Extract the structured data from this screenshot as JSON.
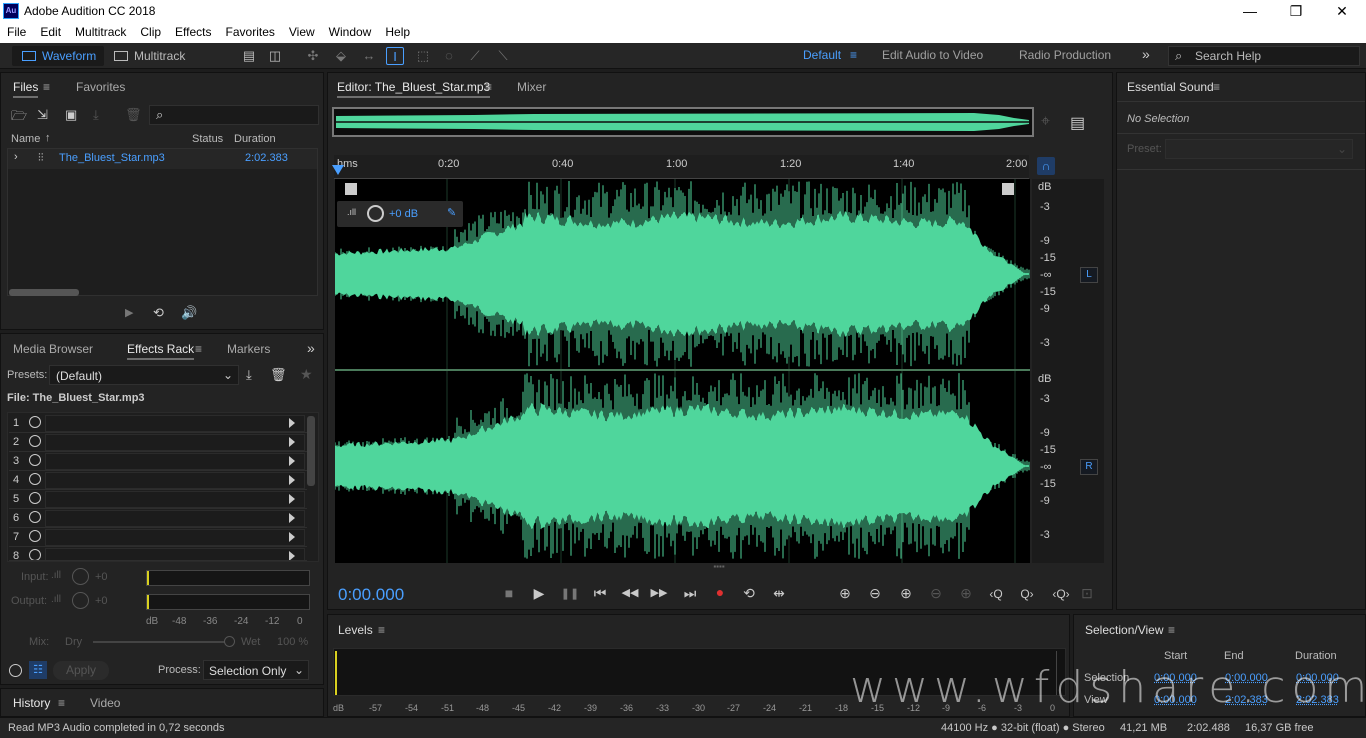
{
  "app": {
    "title": "Adobe Audition CC 2018",
    "icon_label": "Au"
  },
  "window_controls": {
    "minimize": "—",
    "maximize": "❐",
    "close": "✕"
  },
  "menu": [
    "File",
    "Edit",
    "Multitrack",
    "Clip",
    "Effects",
    "Favorites",
    "View",
    "Window",
    "Help"
  ],
  "toolbar": {
    "waveform_label": "Waveform",
    "multitrack_label": "Multitrack",
    "workspaces": [
      "Default",
      "Edit Audio to Video",
      "Radio Production"
    ],
    "more": "»",
    "search_placeholder": "Search Help"
  },
  "files_panel": {
    "tabs": [
      "Files",
      "Favorites"
    ],
    "columns": [
      "Name",
      "Status",
      "Duration"
    ],
    "files": [
      {
        "name": "The_Bluest_Star.mp3",
        "status": "",
        "duration": "2:02.383"
      }
    ]
  },
  "effects_panel": {
    "tabs": [
      "Media Browser",
      "Effects Rack",
      "Markers"
    ],
    "presets_label": "Presets:",
    "preset_value": "(Default)",
    "file_label": "File: The_Bluest_Star.mp3",
    "slots": [
      "1",
      "2",
      "3",
      "4",
      "5",
      "6",
      "7",
      "8"
    ],
    "input_label": "Input:",
    "input_value": "+0",
    "output_label": "Output:",
    "output_value": "+0",
    "meter_ticks": [
      "dB",
      "-48",
      "-36",
      "-24",
      "-12",
      "0"
    ],
    "mix_label": "Mix:",
    "dry_label": "Dry",
    "wet_label": "Wet",
    "wet_value": "100 %",
    "apply_label": "Apply",
    "process_label": "Process:",
    "process_value": "Selection Only"
  },
  "history_panel": {
    "tabs": [
      "History",
      "Video"
    ],
    "message": "Read MP3 Audio completed in 0,72 seconds"
  },
  "editor": {
    "tab_label": "Editor: The_Bluest_Star.mp3",
    "mixer_label": "Mixer",
    "ruler_labels": [
      "hms",
      "0:20",
      "0:40",
      "1:00",
      "1:20",
      "1:40",
      "2:00"
    ],
    "gain_value": "+0 dB",
    "db_scale": [
      "dB",
      "-3",
      "-9",
      "-15",
      "-∞",
      "-15",
      "-9",
      "-3"
    ],
    "channel_left": "L",
    "channel_right": "R",
    "time": "0:00.000",
    "wave_color": "#4fd69c"
  },
  "transport": [
    "■",
    "▶",
    "❚❚",
    "⏮",
    "◀◀",
    "▶▶",
    "⏭",
    "●",
    "⟲",
    "⇹"
  ],
  "zoom_controls": [
    "⊕",
    "⊖",
    "⊕",
    "⊖",
    "⊕",
    "‹Q",
    "Q›",
    "‹Q›",
    "⊡"
  ],
  "essential_sound": {
    "title": "Essential Sound",
    "no_selection": "No Selection",
    "preset_label": "Preset:"
  },
  "levels": {
    "title": "Levels",
    "scale": [
      "dB",
      "-57",
      "-54",
      "-51",
      "-48",
      "-45",
      "-42",
      "-39",
      "-36",
      "-33",
      "-30",
      "-27",
      "-24",
      "-21",
      "-18",
      "-15",
      "-12",
      "-9",
      "-6",
      "-3",
      "0"
    ]
  },
  "selection_view": {
    "title": "Selection/View",
    "cols": [
      "Start",
      "End",
      "Duration"
    ],
    "selection_label": "Selection",
    "selection": [
      "0:00.000",
      "0:00.000",
      "0:00.000"
    ],
    "view_label": "View",
    "view": [
      "0:00.000",
      "2:02.383",
      "2:02.383"
    ]
  },
  "status": {
    "format": "44100 Hz ● 32-bit (float) ● Stereo",
    "size": "41,21 MB",
    "duration": "2:02.488",
    "free": "16,37 GB free"
  },
  "watermark": "www.wfdshare.com"
}
